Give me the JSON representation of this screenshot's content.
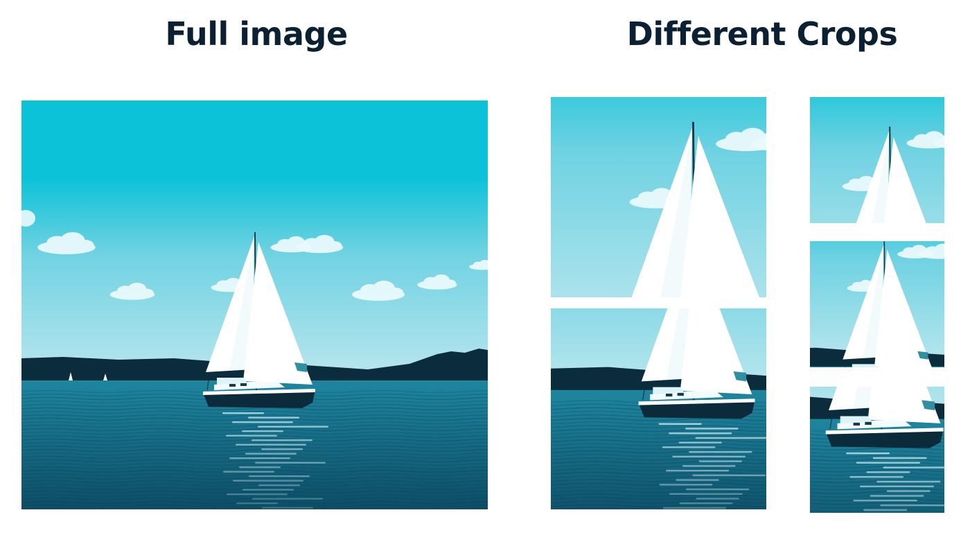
{
  "titles": {
    "full_image": "Full image",
    "different_crops": "Different Crops"
  },
  "colors": {
    "title": "#0c2033",
    "sky_top": "#0bc2d8",
    "sky_horizon": "#b9e6ee",
    "cloud": "#eafafd",
    "treeline": "#0b2c3c",
    "water_top": "#1f86a0",
    "water_bottom": "#0d4d66",
    "sail": "#ffffff",
    "sail_shade": "#e7f6f9",
    "hull": "#0b2a3a",
    "reflection": "#cfeff5"
  },
  "crops": [
    {
      "name": "crop-large-top"
    },
    {
      "name": "crop-large-bottom"
    },
    {
      "name": "crop-small-top"
    },
    {
      "name": "crop-small-middle"
    },
    {
      "name": "crop-small-bottom"
    }
  ]
}
